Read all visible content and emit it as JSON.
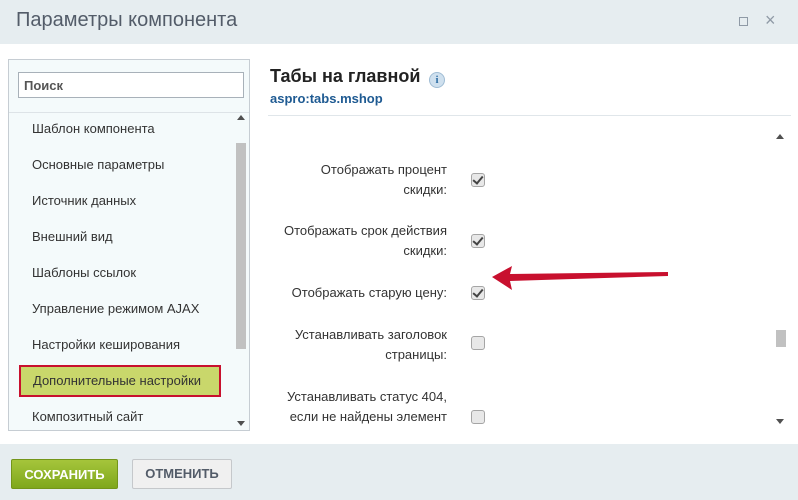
{
  "window": {
    "title": "Параметры компонента"
  },
  "sidebar": {
    "search_placeholder": "Поиск",
    "items": [
      {
        "label": "Шаблон компонента"
      },
      {
        "label": "Основные параметры"
      },
      {
        "label": "Источник данных"
      },
      {
        "label": "Внешний вид"
      },
      {
        "label": "Шаблоны ссылок"
      },
      {
        "label": "Управление режимом AJAX"
      },
      {
        "label": "Настройки кеширования"
      },
      {
        "label": "Дополнительные настройки",
        "active": true
      },
      {
        "label": "Композитный сайт"
      }
    ]
  },
  "component": {
    "title": "Табы на главной",
    "code": "aspro:tabs.mshop"
  },
  "settings": [
    {
      "line1": "Отображать процент",
      "line2": "скидки:",
      "checked": true
    },
    {
      "line1": "Отображать срок действия",
      "line2": "скидки:",
      "checked": true
    },
    {
      "line1": "Отображать старую цену:",
      "line2": "",
      "checked": true
    },
    {
      "line1": "Устанавливать заголовок",
      "line2": "страницы:",
      "checked": false
    },
    {
      "line1": "Устанавливать статус 404,",
      "line2": "если не найдены элемент",
      "checked": false
    }
  ],
  "footer": {
    "save_label": "СОХРАНИТЬ",
    "cancel_label": "ОТМЕНИТЬ"
  },
  "colors": {
    "highlight_border": "#c8102e",
    "active_item_bg": "#c9d76b",
    "save_button": "#8cb229",
    "annotation_arrow": "#c8102e"
  }
}
